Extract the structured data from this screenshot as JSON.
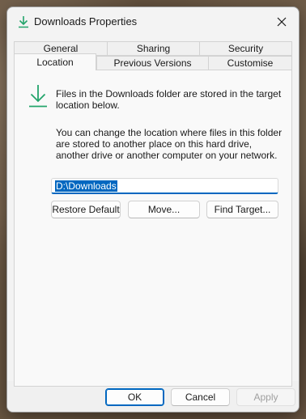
{
  "window": {
    "title": "Downloads Properties",
    "title_icon": "download-arrow-icon",
    "close_icon": "close-icon"
  },
  "tabs": {
    "row1": [
      "General",
      "Sharing",
      "Security"
    ],
    "row2": [
      "Location",
      "Previous Versions",
      "Customise"
    ],
    "active": "Location"
  },
  "location": {
    "folder_icon": "download-arrow-icon",
    "info": "Files in the Downloads folder are stored in the target location below.",
    "description": "You can change the location where files in this folder are stored to another place on this hard drive, another drive or another computer on your network.",
    "path_value": "D:\\Downloads",
    "buttons": {
      "restore_default": "Restore Default",
      "move": "Move...",
      "find_target": "Find Target..."
    }
  },
  "footer": {
    "ok": "OK",
    "cancel": "Cancel",
    "apply": "Apply"
  },
  "colors": {
    "accent": "#0067c0",
    "icon_green": "#23a46b"
  }
}
